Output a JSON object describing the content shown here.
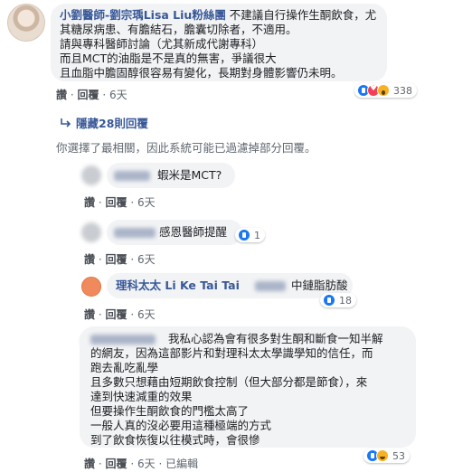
{
  "comment_main": {
    "author": "小劉醫師-劉宗瑀Lisa Liu粉絲團",
    "first_line_text": " 不建議自行操作生酮飲食，尤",
    "lines": [
      "其糖尿病患、有膽結石，膽囊切除者，不適用。",
      "請與專科醫師討論（尤其新成代謝專科）",
      "而且MCT的油脂是不是真的無害，爭議很大",
      "且血脂中膽固醇很容易有變化，長期對身體影響仍未明。"
    ],
    "actions": {
      "like": "讚",
      "sep": "·",
      "reply": "回覆",
      "time": "6天"
    },
    "reaction_count": "338",
    "reaction_icons": [
      "like-icon",
      "love-icon",
      "wow-icon"
    ]
  },
  "hidden_replies": {
    "label": "隱藏28則回覆"
  },
  "notice": "你選擇了最相關，因此系統可能已過濾掉部分回覆。",
  "reply_1": {
    "text": "蝦米是MCT?",
    "actions": {
      "like": "讚",
      "sep": "·",
      "reply": "回覆",
      "time": "6天"
    }
  },
  "reply_2": {
    "text": "感恩醫師提醒",
    "reaction_count": "1",
    "actions": {
      "like": "讚",
      "sep": "·",
      "reply": "回覆",
      "time": "6天"
    }
  },
  "reply_3": {
    "author": "理科太太 Li Ke Tai Tai",
    "text": " 中鏈脂肪酸",
    "reaction_count": "18",
    "actions": {
      "like": "讚",
      "sep": "·",
      "reply": "回覆",
      "time": "6天"
    }
  },
  "reply_4": {
    "first_line_text": "我私心認為會有很多對生酮和斷食一知半解",
    "lines": [
      "的網友，因為這部影片和對理科太太學識學知的信任，而",
      "跑去亂吃亂學",
      "且多數只想藉由短期飲食控制（但大部分都是節食），來",
      "達到快速減重的效果",
      "但要操作生酮飲食的門檻太高了",
      "一般人真的沒必要用這種極端的方式",
      "到了飲食恢復以往模式時，會很慘"
    ],
    "reaction_count": "53",
    "actions": {
      "like": "讚",
      "sep": "·",
      "reply": "回覆",
      "time": "6天",
      "edited": "已編輯"
    }
  },
  "colors": {
    "link": "#385898",
    "bubble": "#f2f3f5",
    "meta": "#606770"
  }
}
